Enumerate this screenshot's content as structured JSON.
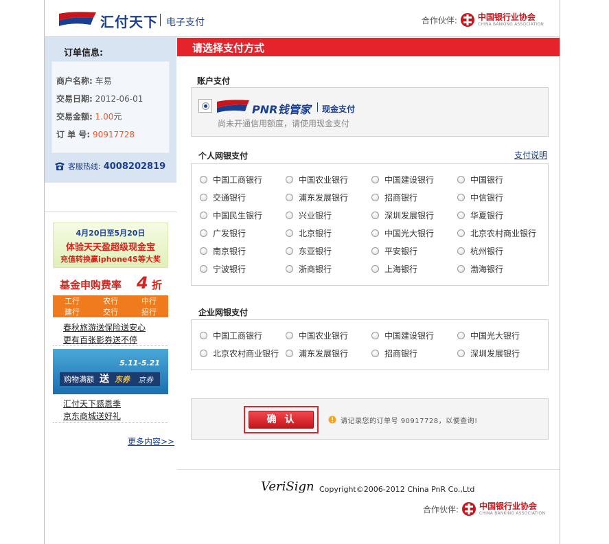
{
  "header": {
    "brand": "汇付天下",
    "sub": "电子支付",
    "partner_label": "合作伙伴:",
    "partner_name": "中国银行业协会",
    "partner_en": "CHINA BANKING ASSOCIATION"
  },
  "order": {
    "title": "订单信息:",
    "rows": [
      {
        "k": "商户名称:",
        "v": "车易"
      },
      {
        "k": "交易日期:",
        "v": "2012-06-01"
      },
      {
        "k": "交易金额:",
        "v": "1.00",
        "unit": "元"
      },
      {
        "k": "订 单 号:",
        "v": "90917728"
      }
    ],
    "hotline_label": "客服热线:",
    "hotline_number": "4008202819"
  },
  "promos": {
    "banner1_line1": "4月20日至5月20日",
    "banner1_line2": "体验天天盈超级现金宝",
    "banner1_line3": "充值转换赢iphone4S等大奖",
    "banner2_text": "基金申购费率",
    "banner2_num": "4",
    "banner2_unit": "折",
    "banner3_banks": [
      "工行",
      "农行",
      "中行",
      "建行",
      "交行",
      "招行"
    ],
    "link1": "春秋旅游送保险送安心",
    "link2": "更有百张影券送不停",
    "banner4_date": "5.11-5.21",
    "banner4_a": "购物满额",
    "banner4_b": "送",
    "banner4_c": "东券",
    "banner4_d": "京券",
    "link3": "汇付天下感恩季",
    "link4": "京东商城送好礼",
    "more": "更多内容>>"
  },
  "main": {
    "title": "请选择支付方式",
    "account_label": "账户支付",
    "pnr_brand": "PNR钱管家",
    "pnr_sub": "现金支付",
    "account_note": "尚未开通信用额度，请使用现金支付",
    "personal_label": "个人网银支付",
    "pay_help": "支付说明",
    "personal_banks": [
      "中国工商银行",
      "中国农业银行",
      "中国建设银行",
      "中国银行",
      "交通银行",
      "浦东发展银行",
      "招商银行",
      "中信银行",
      "中国民生银行",
      "兴业银行",
      "深圳发展银行",
      "华夏银行",
      "广发银行",
      "北京银行",
      "中国光大银行",
      "北京农村商业银行",
      "南京银行",
      "东亚银行",
      "平安银行",
      "杭州银行",
      "宁波银行",
      "浙商银行",
      "上海银行",
      "渤海银行"
    ],
    "corporate_label": "企业网银支付",
    "corporate_banks": [
      "中国工商银行",
      "中国农业银行",
      "中国建设银行",
      "中国光大银行",
      "北京农村商业银行",
      "浦东发展银行",
      "招商银行",
      "深圳发展银行"
    ],
    "confirm_label": "确认",
    "notice_prefix": "请记录您的订单号",
    "notice_order": "90917728",
    "notice_suffix": "，以便查询!"
  },
  "footer": {
    "verisign": "VeriSign",
    "copyright": "Copyright©2006-2012 China PnR Co.,Ltd",
    "partner_label": "合作伙伴:",
    "partner_name": "中国银行业协会",
    "partner_en": "CHINA BANKING ASSOCIATION"
  },
  "colors": {
    "brand_blue": "#1b3f8f",
    "accent_red": "#e4232a",
    "amount_red": "#e8562a",
    "sidebar_bg": "#d8e4f2"
  }
}
